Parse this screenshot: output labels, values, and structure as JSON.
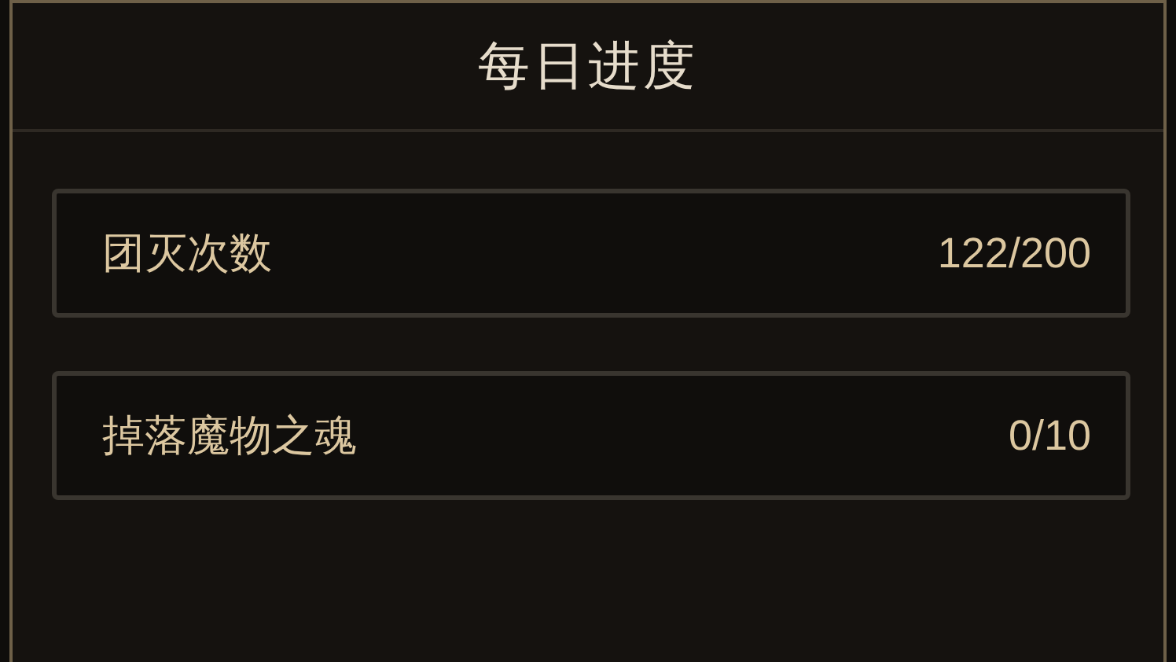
{
  "dialog": {
    "title": "每日进度"
  },
  "rows": [
    {
      "label": "团灭次数",
      "value": "122/200"
    },
    {
      "label": "掉落魔物之魂",
      "value": "0/10"
    }
  ]
}
